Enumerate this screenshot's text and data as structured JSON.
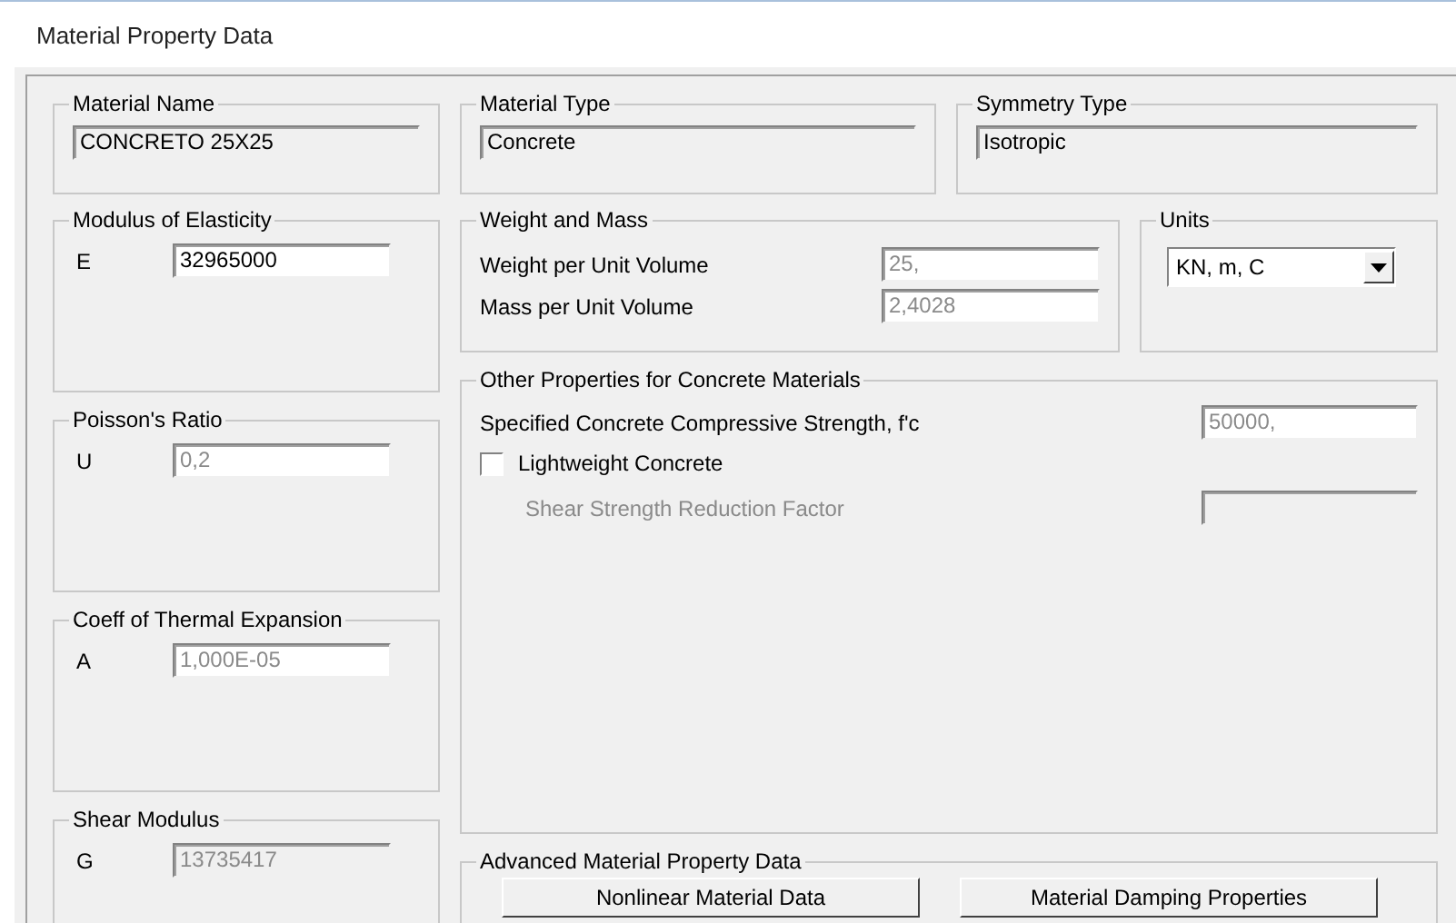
{
  "window": {
    "title": "Material Property Data"
  },
  "material_name": {
    "label": "Material Name",
    "value": "CONCRETO 25X25",
    "kind": "readonly"
  },
  "material_type": {
    "label": "Material Type",
    "value": "Concrete",
    "kind": "readonly"
  },
  "symmetry_type": {
    "label": "Symmetry Type",
    "value": "Isotropic",
    "kind": "readonly"
  },
  "left_groups": [
    {
      "label": "Modulus of Elasticity",
      "symbol": "E",
      "value": "32965000",
      "kind": "edit"
    },
    {
      "label": "Poisson's Ratio",
      "symbol": "U",
      "value": "0,2",
      "kind": "disabled"
    },
    {
      "label": "Coeff of Thermal Expansion",
      "symbol": "A",
      "value": "1,000E-05",
      "kind": "disabled"
    },
    {
      "label": "Shear Modulus",
      "symbol": "G",
      "value": "13735417",
      "kind": "locked"
    }
  ],
  "weight_and_mass": {
    "label": "Weight and Mass",
    "rows": [
      {
        "label": "Weight per Unit Volume",
        "value": "25,",
        "kind": "disabled"
      },
      {
        "label": "Mass per Unit Volume",
        "value": "2,4028",
        "kind": "disabled"
      }
    ]
  },
  "units": {
    "label": "Units",
    "value": "KN, m, C"
  },
  "concrete": {
    "label": "Other Properties for Concrete Materials",
    "strength": {
      "label": "Specified Concrete Compressive Strength, f'c",
      "value": "50000,",
      "kind": "disabled"
    },
    "lightweight": {
      "label": "Lightweight Concrete",
      "checked": false
    },
    "reduction": {
      "label": "Shear Strength Reduction Factor",
      "disabled": true
    }
  },
  "advanced": {
    "label": "Advanced Material Property Data",
    "buttons": [
      "Nonlinear Material Data",
      "Material Damping Properties"
    ]
  }
}
